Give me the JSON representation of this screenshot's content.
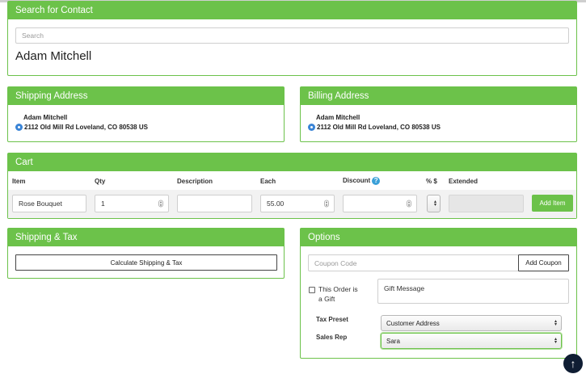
{
  "search_contact": {
    "title": "Search for Contact",
    "search_placeholder": "Search",
    "contact_name": "Adam Mitchell"
  },
  "shipping_address": {
    "title": "Shipping Address",
    "name": "Adam Mitchell",
    "address": "2112 Old Mill Rd Loveland, CO 80538 US"
  },
  "billing_address": {
    "title": "Billing Address",
    "name": "Adam Mitchell",
    "address": "2112 Old Mill Rd Loveland, CO 80538 US"
  },
  "cart": {
    "title": "Cart",
    "columns": {
      "item": "Item",
      "qty": "Qty",
      "description": "Description",
      "each": "Each",
      "discount": "Discount",
      "percent_dollar": "% $",
      "extended": "Extended"
    },
    "row": {
      "item": "Rose Bouquet",
      "qty": "1",
      "description": "",
      "each": "55.00",
      "discount": "",
      "extended": ""
    },
    "add_item_label": "Add Item"
  },
  "shipping_tax": {
    "title": "Shipping & Tax",
    "calculate_label": "Calculate Shipping & Tax"
  },
  "options": {
    "title": "Options",
    "coupon_placeholder": "Coupon Code",
    "add_coupon_label": "Add Coupon",
    "gift_label_line1": "This Order is",
    "gift_label_line2": "a Gift",
    "gift_message_placeholder": "Gift Message",
    "tax_preset_label": "Tax Preset",
    "tax_preset_value": "Customer Address",
    "sales_rep_label": "Sales Rep",
    "sales_rep_value": "Sara"
  },
  "scroll_top_icon": "arrow-up-icon",
  "colors": {
    "accent_green": "#6cc24a",
    "info_blue": "#3a84d6",
    "dark_button": "#0f1d33"
  }
}
